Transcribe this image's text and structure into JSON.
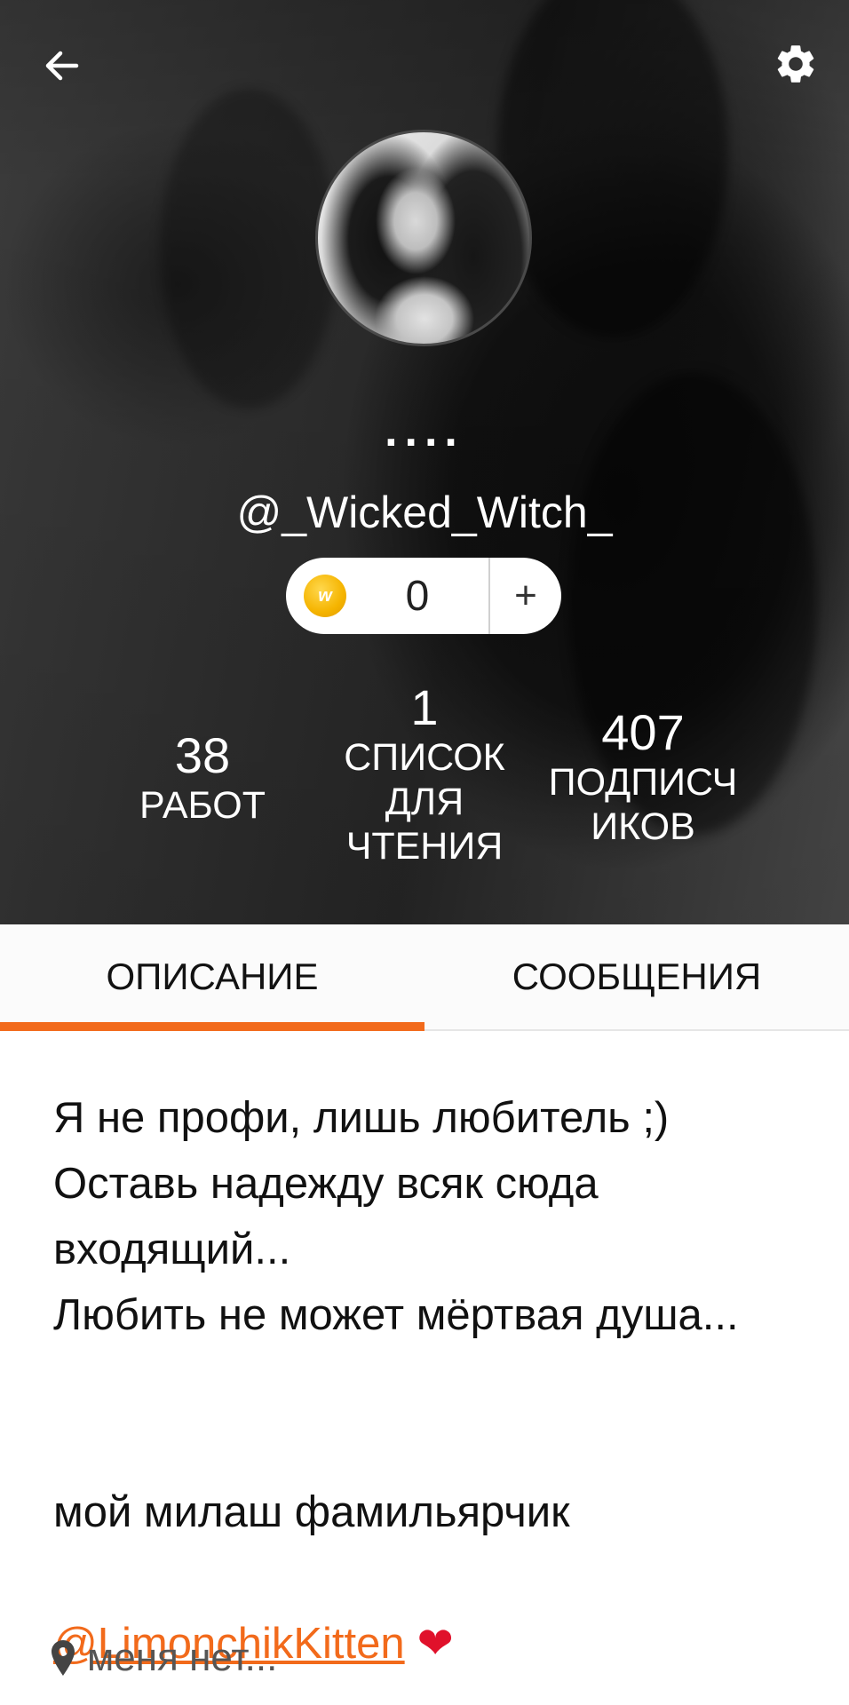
{
  "header": {
    "display_name": "....",
    "username": "@_Wicked_Witch_",
    "coins": {
      "count": "0",
      "add_label": "+",
      "icon": "coin-icon",
      "icon_letter": "w",
      "color": "#f5b400"
    }
  },
  "stats": {
    "works": {
      "value": "38",
      "label": "РАБОТ"
    },
    "reading_lists": {
      "value": "1",
      "label": "СПИСОК ДЛЯ ЧТЕНИЯ"
    },
    "followers": {
      "value": "407",
      "label": "ПОДПИСЧИКОВ"
    }
  },
  "tabs": [
    {
      "label": "ОПИСАНИЕ",
      "active": true
    },
    {
      "label": "СООБЩЕНИЯ",
      "active": false
    }
  ],
  "description": {
    "text": "Я не профи, лишь любитель ;)\nОставь надежду всяк сюда входящий...\nЛюбить не может мёртвая душа...",
    "mention_prefix": "мой милаш фамильярчик",
    "mention_link": "@LimonchikKitten",
    "mention_emoji": "❤"
  },
  "location": {
    "text": "меня нет...",
    "icon": "location-pin-icon"
  },
  "icons": {
    "back": "arrow-left-icon",
    "settings": "gear-icon"
  },
  "colors": {
    "accent": "#f26a1b",
    "heart": "#e0112b"
  }
}
